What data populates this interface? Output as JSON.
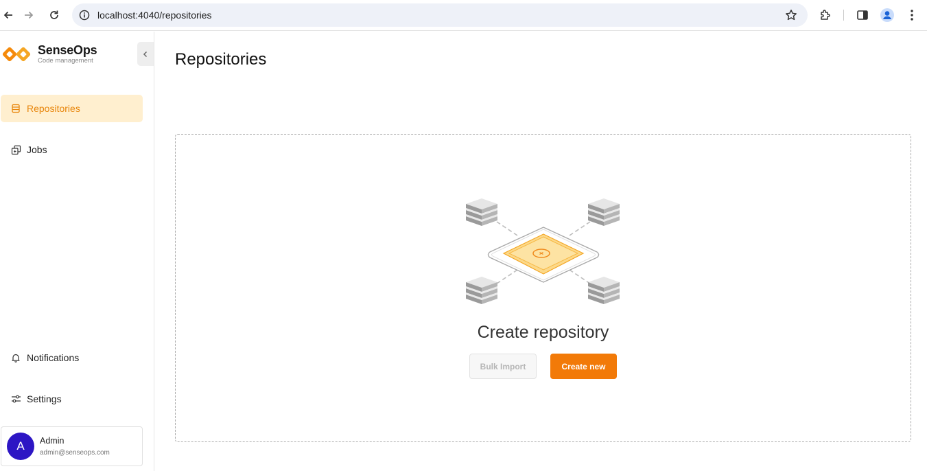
{
  "browser": {
    "url": "localhost:4040/repositories",
    "icons": [
      "back-arrow-icon",
      "forward-arrow-icon",
      "reload-icon",
      "site-info-icon",
      "bookmark-star-icon",
      "extensions-icon",
      "side-panel-icon",
      "profile-icon",
      "menu-dots-icon"
    ]
  },
  "brand": {
    "name": "SenseOps",
    "subtitle": "Code management",
    "color": "#f27a08"
  },
  "sidebar": {
    "items": [
      {
        "label": "Repositories",
        "icon": "repository-icon",
        "active": true
      },
      {
        "label": "Jobs",
        "icon": "jobs-icon",
        "active": false
      }
    ],
    "bottom_items": [
      {
        "label": "Notifications",
        "icon": "bell-icon"
      },
      {
        "label": "Settings",
        "icon": "sliders-icon"
      }
    ],
    "active_color": "#e8850a",
    "active_bg": "#ffefcf"
  },
  "user": {
    "initial": "A",
    "name": "Admin",
    "email": "admin@senseops.com",
    "avatar_color": "#2d16c4"
  },
  "main": {
    "title": "Repositories",
    "empty_state": {
      "title": "Create repository",
      "illustration": "repository-hub-illustration",
      "bulk_import_label": "Bulk Import",
      "create_new_label": "Create new"
    }
  }
}
